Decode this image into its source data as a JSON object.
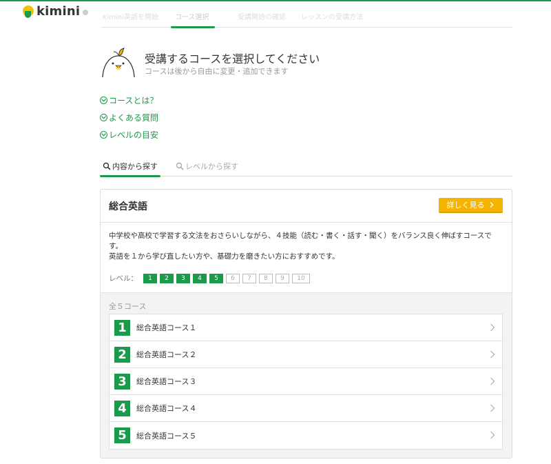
{
  "header": {
    "logo_text": "kimini",
    "steps": [
      "Kimini英語を開始",
      "コース選択",
      "受講開始の確認",
      "レッスンの受講方法"
    ]
  },
  "intro": {
    "title": "受講するコースを選択してください",
    "subtitle": "コースは後から自由に変更・追加できます"
  },
  "faq_links": [
    "コースとは？",
    "よくある質問",
    "レベルの目安"
  ],
  "search_tabs": {
    "active": "内容から探す",
    "inactive": "レベルから探す"
  },
  "course_group": {
    "title": "総合英語",
    "detail_button": "詳しく見る",
    "description_line1": "中学校や高校で学習する文法をおさらいしながら、４技能（読む・書く・話す・聞く）をバランス良く伸ばすコースです。",
    "description_line2": "英語を１から学び直したい方や、基礎力を磨きたい方におすすめです。",
    "level_label": "レベル：",
    "levels": [
      "1",
      "2",
      "3",
      "4",
      "5",
      "6",
      "7",
      "8",
      "9",
      "10"
    ],
    "active_levels": 5,
    "count_text": "全５コース",
    "courses": [
      {
        "num": "1",
        "name": "総合英語コース１"
      },
      {
        "num": "2",
        "name": "総合英語コース２"
      },
      {
        "num": "3",
        "name": "総合英語コース３"
      },
      {
        "num": "4",
        "name": "総合英語コース４"
      },
      {
        "num": "5",
        "name": "総合英語コース５"
      }
    ]
  },
  "colors": {
    "brand_green": "#1a9a4a",
    "button_yellow": "#f4b400"
  }
}
